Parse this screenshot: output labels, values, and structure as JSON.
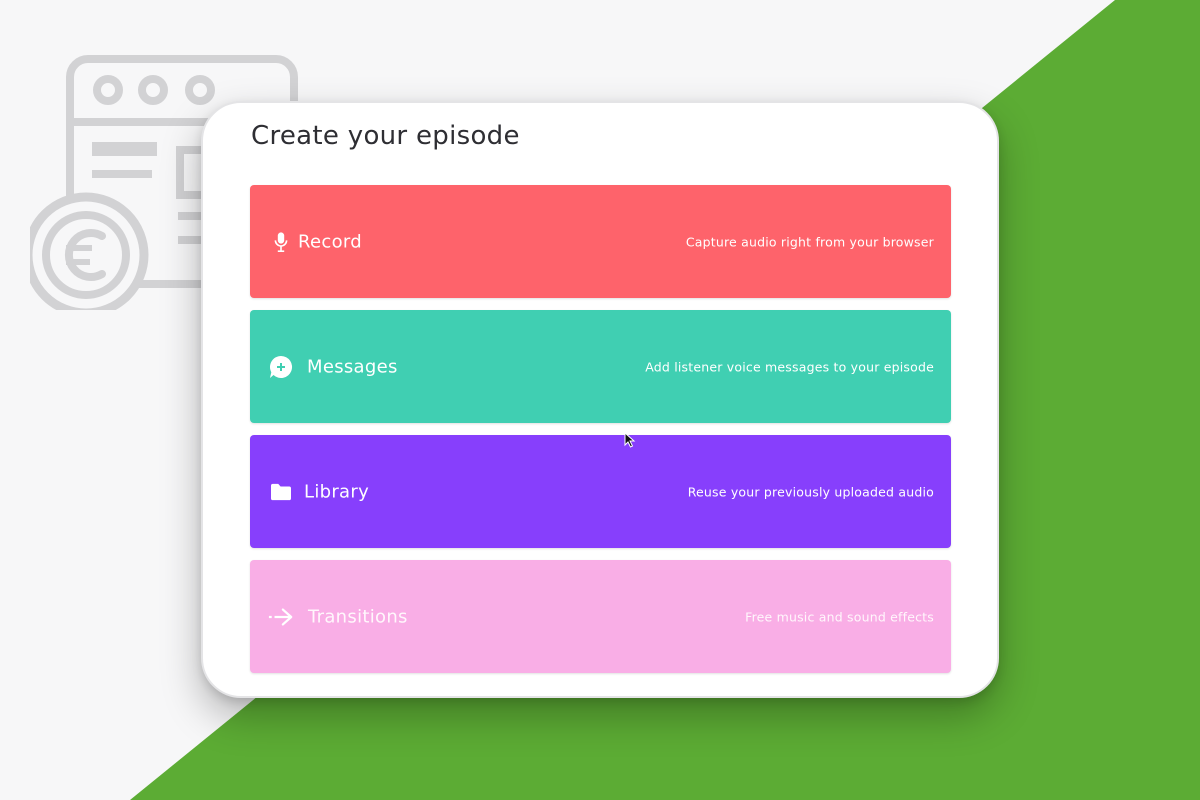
{
  "panel": {
    "title": "Create your episode"
  },
  "options": [
    {
      "id": "record",
      "label": "Record",
      "description": "Capture audio right from your browser",
      "icon": "microphone-icon",
      "color": "#fe636b"
    },
    {
      "id": "messages",
      "label": "Messages",
      "description": "Add listener voice messages to your episode",
      "icon": "add-message-icon",
      "color": "#40cfb2"
    },
    {
      "id": "library",
      "label": "Library",
      "description": "Reuse your previously uploaded audio",
      "icon": "folder-icon",
      "color": "#873ffc"
    },
    {
      "id": "transitions",
      "label": "Transitions",
      "description": "Free music and sound effects",
      "icon": "arrow-right-icon",
      "color": "#f9aee6"
    }
  ],
  "background": {
    "accent": "#5cac34",
    "illustration": "browser-window-euro-icon"
  }
}
